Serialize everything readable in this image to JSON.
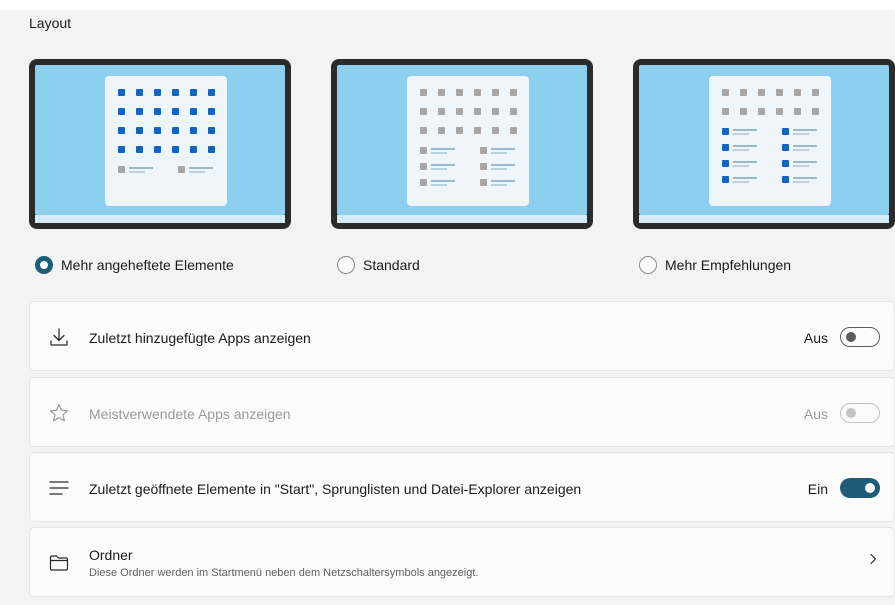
{
  "section_title": "Layout",
  "colors": {
    "accent": "#1e5d78",
    "preview_blue": "#8dcfef",
    "tile_blue": "#1565c0"
  },
  "layout_options": [
    {
      "label": "Mehr angeheftete Elemente",
      "selected": true,
      "pinned_rows": 4,
      "recommended_rows": 1
    },
    {
      "label": "Standard",
      "selected": false,
      "pinned_rows": 3,
      "recommended_rows": 3
    },
    {
      "label": "Mehr Empfehlungen",
      "selected": false,
      "pinned_rows": 2,
      "recommended_rows": 4
    }
  ],
  "settings": [
    {
      "icon": "download-icon",
      "label": "Zuletzt hinzugefügte Apps anzeigen",
      "state": "Aus",
      "on": false,
      "enabled": true
    },
    {
      "icon": "star-icon",
      "label": "Meistverwendete Apps anzeigen",
      "state": "Aus",
      "on": false,
      "enabled": false
    },
    {
      "icon": "list-icon",
      "label": "Zuletzt geöffnete Elemente in \"Start\", Sprunglisten und Datei-Explorer anzeigen",
      "state": "Ein",
      "on": true,
      "enabled": true
    }
  ],
  "folders": {
    "icon": "folder-icon",
    "title": "Ordner",
    "description": "Diese Ordner werden im Startmenü neben dem Netzschaltersymbols angezeigt."
  }
}
